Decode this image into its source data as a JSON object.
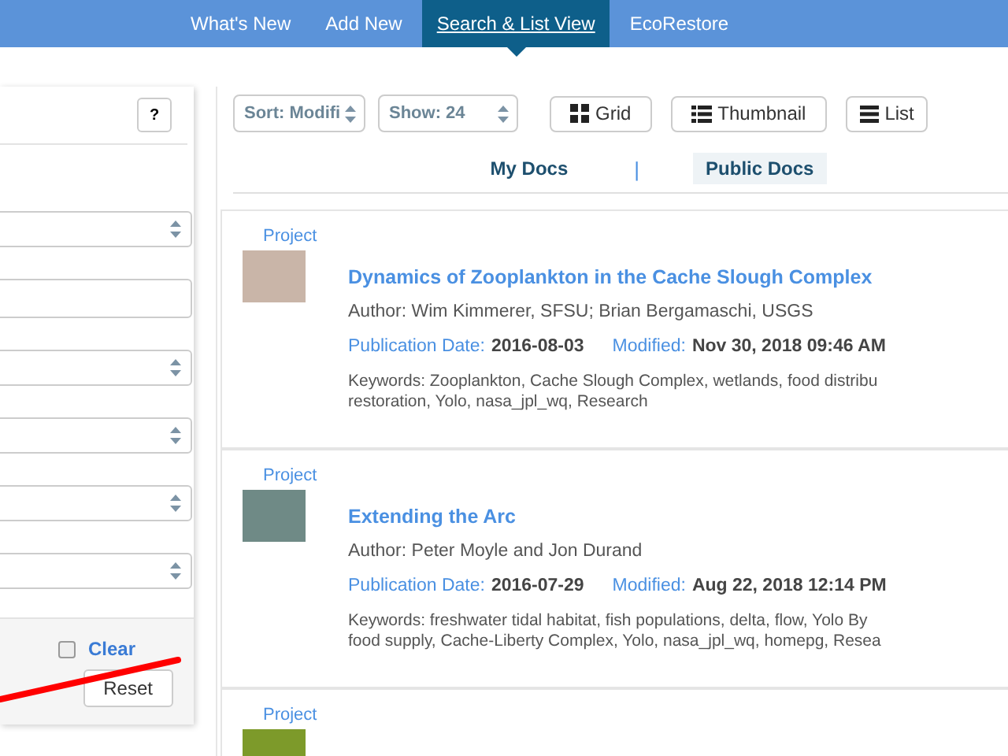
{
  "nav": {
    "tabs": [
      {
        "label": "What's New",
        "selected": false
      },
      {
        "label": "Add New",
        "selected": false
      },
      {
        "label": "Search & List View",
        "selected": true
      },
      {
        "label": "EcoRestore",
        "selected": false
      }
    ]
  },
  "filters": {
    "fields": [
      {
        "kind": "select"
      },
      {
        "kind": "input"
      },
      {
        "kind": "select"
      },
      {
        "kind": "select"
      },
      {
        "kind": "select"
      },
      {
        "kind": "select"
      }
    ],
    "help_button": "?",
    "clear_checkbox": {
      "checked": false
    },
    "clear_link": "Clear",
    "reset_button": "Reset"
  },
  "toolbar": {
    "sort": "Sort: Modifi",
    "show": "Show: 24",
    "views": [
      {
        "kind": "grid",
        "label": "Grid"
      },
      {
        "kind": "thumbnail",
        "label": "Thumbnail"
      },
      {
        "kind": "list",
        "label": "List"
      }
    ]
  },
  "doc_tabs": [
    {
      "label": "My Docs",
      "selected": false
    },
    {
      "label": "Public Docs",
      "selected": true
    }
  ],
  "doc_tab_separator": "|",
  "results": [
    {
      "type": "Project",
      "title": "Dynamics of Zooplankton in the Cache Slough Complex",
      "author": "Author: Wim Kimmerer, SFSU; Brian Bergamaschi, USGS",
      "pub_label": "Publication Date:",
      "pub_date": "2016-08-03",
      "mod_label": "Modified:",
      "modified": "Nov 30, 2018 09:46 AM",
      "keywords": [
        "Keywords: Zooplankton, Cache Slough Complex, wetlands, food distribu",
        "restoration, Yolo, nasa_jpl_wq, Research"
      ]
    },
    {
      "type": "Project",
      "title": "Extending the Arc",
      "author": "Author: Peter Moyle and Jon Durand",
      "pub_label": "Publication Date:",
      "pub_date": "2016-07-29",
      "mod_label": "Modified:",
      "modified": "Aug 22, 2018 12:14 PM",
      "keywords": [
        "Keywords: freshwater tidal habitat, fish populations, delta, flow, Yolo By",
        "food supply, Cache-Liberty Complex, Yolo, nasa_jpl_wq, homepg, Resea"
      ]
    },
    {
      "type": "Project"
    }
  ]
}
